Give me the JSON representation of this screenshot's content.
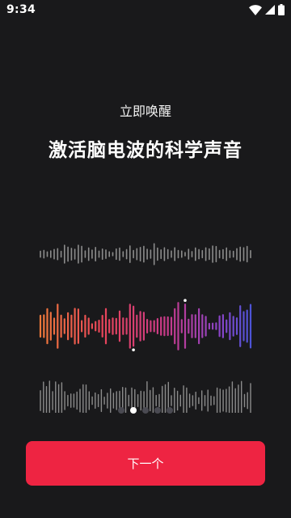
{
  "status_bar": {
    "time": "9:34",
    "icons": [
      "wifi-icon",
      "cellular-signal-icon",
      "battery-icon"
    ]
  },
  "onboarding": {
    "subtitle": "立即唤醒",
    "headline": "激活脑电波的科学声音",
    "next_button_label": "下一个",
    "page_indicator": {
      "count": 5,
      "active_index": 1
    }
  },
  "colors": {
    "background": "#19191b",
    "button": "#ee2442",
    "wave_gray": "#8c8c8c",
    "wave_gradient": [
      "#f07a3a",
      "#e8445a",
      "#c83a8a",
      "#8a44c8",
      "#4a55d8"
    ],
    "dot_inactive": "#4a4a52",
    "dot_active": "#ffffff"
  }
}
